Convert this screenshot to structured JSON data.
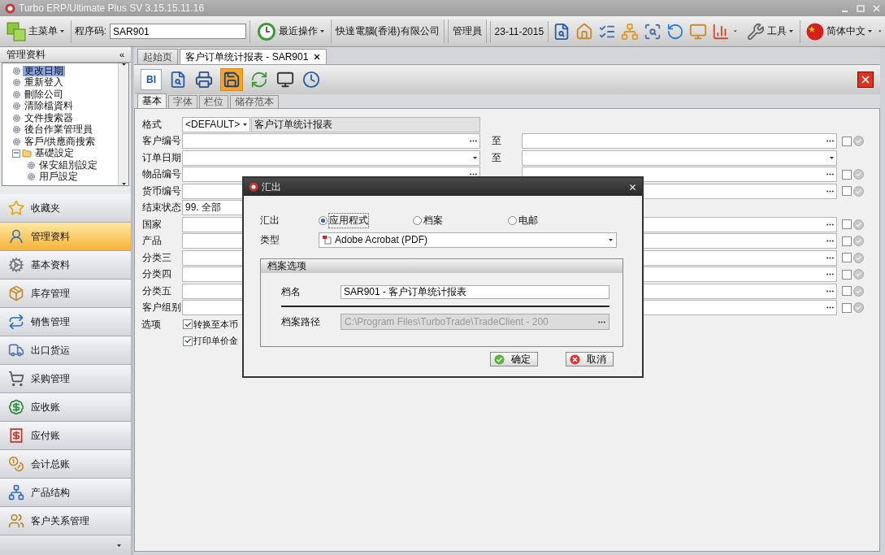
{
  "window": {
    "title": "Turbo ERP/Ultimate Plus SV 3.15.15.11.16"
  },
  "toolbar": {
    "main_menu": "主菜单",
    "program_code_label": "程序码:",
    "program_code": "SAR901",
    "recent": "最近操作",
    "company": "快達電腦(香港)有限公司",
    "user": "管理員",
    "date": "23-11-2015",
    "tools": "工具",
    "language": "简体中文"
  },
  "sidebar": {
    "title": "管理资料",
    "collapse": "«",
    "tree": [
      {
        "label": "更改日期",
        "kind": "action",
        "selected": true
      },
      {
        "label": "重新登入",
        "kind": "action",
        "selected": false
      },
      {
        "label": "刪除公司",
        "kind": "action",
        "selected": false
      },
      {
        "label": "清除檔資料",
        "kind": "action",
        "selected": false
      },
      {
        "label": "文件搜索器",
        "kind": "action",
        "selected": false
      },
      {
        "label": "後台作業管理員",
        "kind": "action",
        "selected": false
      },
      {
        "label": "客戶/供應商搜索",
        "kind": "action",
        "selected": false
      },
      {
        "label": "基礎設定",
        "kind": "folder",
        "selected": false,
        "expanded": true,
        "children": [
          {
            "label": "保安組別設定",
            "kind": "action",
            "selected": false
          },
          {
            "label": "用戶設定",
            "kind": "action",
            "selected": false
          }
        ]
      }
    ],
    "modules": [
      {
        "label": "收藏夹",
        "selected": false
      },
      {
        "label": "管理资料",
        "selected": true
      },
      {
        "label": "基本资料",
        "selected": false
      },
      {
        "label": "库存管理",
        "selected": false
      },
      {
        "label": "销售管理",
        "selected": false
      },
      {
        "label": "出口货运",
        "selected": false
      },
      {
        "label": "采购管理",
        "selected": false
      },
      {
        "label": "应收账",
        "selected": false
      },
      {
        "label": "应付账",
        "selected": false
      },
      {
        "label": "会计总账",
        "selected": false
      },
      {
        "label": "产品结构",
        "selected": false
      },
      {
        "label": "客户关系管理",
        "selected": false
      }
    ]
  },
  "document_tabs": [
    {
      "label": "起始页",
      "selected": false,
      "closable": false
    },
    {
      "label": "客户订单统计报表 - SAR901",
      "selected": true,
      "closable": true
    }
  ],
  "report_toolbar": {
    "bi_label": "BI"
  },
  "form_tabs": [
    {
      "label": "基本",
      "selected": true
    },
    {
      "label": "字体",
      "selected": false
    },
    {
      "label": "栏位",
      "selected": false
    },
    {
      "label": "储存范本",
      "selected": false
    }
  ],
  "form": {
    "rows": [
      {
        "label": "格式",
        "kind": "format",
        "value": "<DEFAULT>",
        "description": "客户订单统计报表"
      },
      {
        "label": "客户编号",
        "kind": "lookup",
        "to": "至",
        "has_range": true,
        "checked": false
      },
      {
        "label": "订单日期",
        "kind": "date",
        "to": "至",
        "has_range": true
      },
      {
        "label": "物品编号",
        "kind": "lookup",
        "has_range": true,
        "checked": false
      },
      {
        "label": "货币编号",
        "kind": "lookup",
        "has_range": true,
        "checked": false
      },
      {
        "label": "结束状态",
        "kind": "select",
        "value": "99. 全部"
      },
      {
        "label": "国家",
        "kind": "lookup",
        "has_range": true,
        "checked": false
      },
      {
        "label": "产品",
        "kind": "lookup",
        "has_range": true,
        "checked": false
      },
      {
        "label": "分类三",
        "kind": "lookup",
        "has_range": true,
        "checked": false
      },
      {
        "label": "分类四",
        "kind": "lookup",
        "has_range": true,
        "checked": false
      },
      {
        "label": "分类五",
        "kind": "lookup",
        "has_range": true,
        "checked": false
      },
      {
        "label": "客户组别",
        "kind": "lookup",
        "has_range": true,
        "checked": false
      }
    ],
    "options_label": "选项",
    "options": [
      {
        "label": "转换至本币",
        "checked": true
      },
      {
        "label": "打印单价金",
        "checked": true
      }
    ]
  },
  "dialog": {
    "title": "汇出",
    "export_label": "汇出",
    "targets": [
      {
        "label": "应用程式",
        "selected": true
      },
      {
        "label": "档案",
        "selected": false
      },
      {
        "label": "电邮",
        "selected": false
      }
    ],
    "type_label": "类型",
    "type_value": "Adobe Acrobat (PDF)",
    "group_title": "档案选项",
    "file_name_label": "档名",
    "file_name": "SAR901 - 客户订单统计报表",
    "path_label": "档案路径",
    "path": "C:\\Program Files\\TurboTrade\\TradeClient - 200",
    "ok": "确定",
    "cancel": "取消"
  }
}
